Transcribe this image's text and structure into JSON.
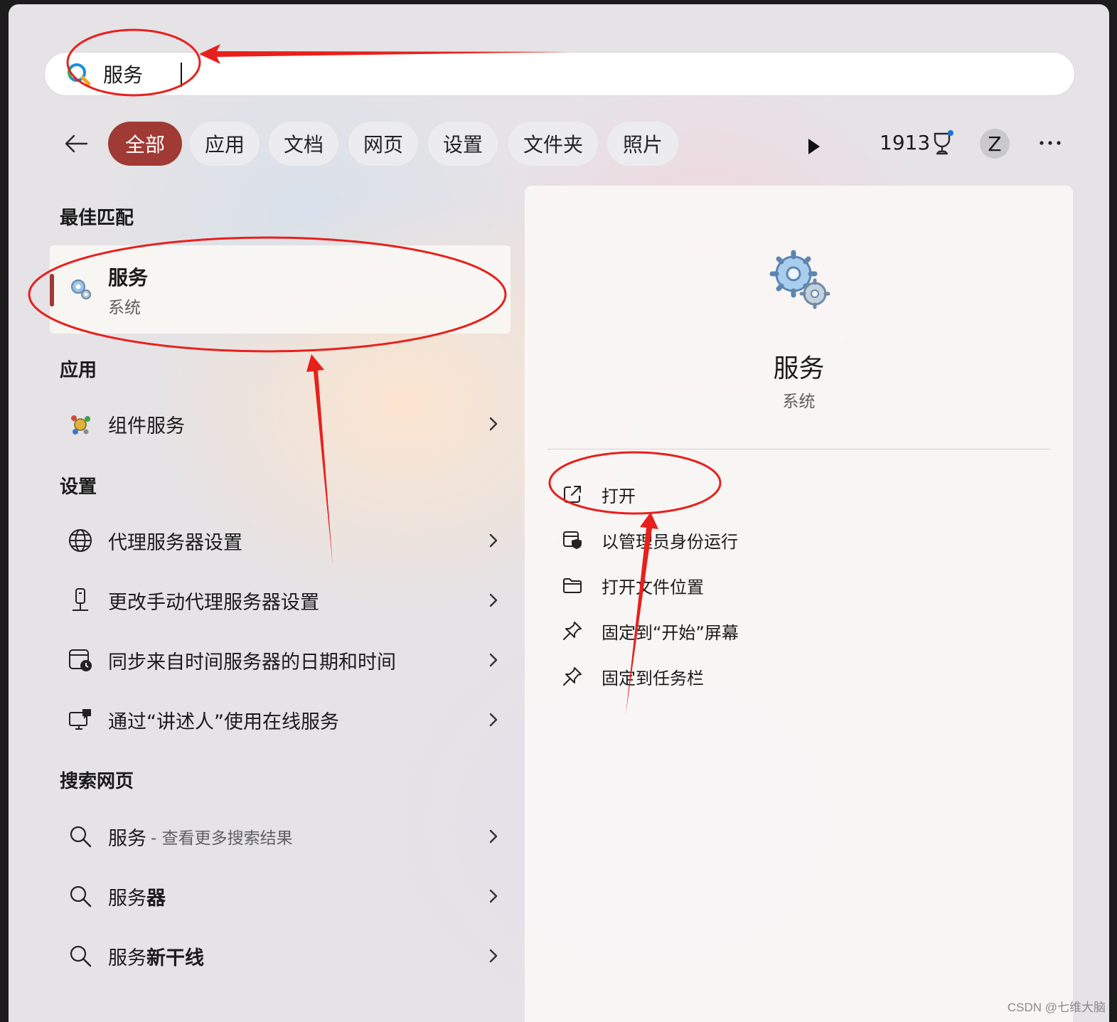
{
  "search": {
    "value": "服务",
    "placeholder": ""
  },
  "filters": [
    {
      "label": "全部",
      "active": true
    },
    {
      "label": "应用",
      "active": false
    },
    {
      "label": "文档",
      "active": false
    },
    {
      "label": "网页",
      "active": false
    },
    {
      "label": "设置",
      "active": false
    },
    {
      "label": "文件夹",
      "active": false
    },
    {
      "label": "照片",
      "active": false
    }
  ],
  "toolbar": {
    "points": "1913",
    "avatar_letter": "Z"
  },
  "best_match": {
    "heading": "最佳匹配",
    "title": "服务",
    "subtitle": "系统",
    "icon": "gears-icon"
  },
  "apps": {
    "heading": "应用",
    "items": [
      {
        "label": "组件服务",
        "icon": "component-services-icon"
      }
    ]
  },
  "settings": {
    "heading": "设置",
    "items": [
      {
        "label": "代理服务器设置",
        "icon": "globe-icon"
      },
      {
        "label": "更改手动代理服务器设置",
        "icon": "network-device-icon"
      },
      {
        "label": "同步来自时间服务器的日期和时间",
        "icon": "calendar-clock-icon"
      },
      {
        "label": "通过“讲述人”使用在线服务",
        "icon": "narrator-icon"
      }
    ]
  },
  "web": {
    "heading": "搜索网页",
    "items": [
      {
        "prefix": "服务",
        "bold": "",
        "suffix": "- 查看更多搜索结果"
      },
      {
        "prefix": "服务",
        "bold": "器",
        "suffix": ""
      },
      {
        "prefix": "服务",
        "bold": "新干线",
        "suffix": ""
      }
    ]
  },
  "detail": {
    "title": "服务",
    "subtitle": "系统",
    "actions": [
      {
        "label": "打开",
        "icon": "open-external-icon"
      },
      {
        "label": "以管理员身份运行",
        "icon": "admin-shield-icon"
      },
      {
        "label": "打开文件位置",
        "icon": "folder-icon"
      },
      {
        "label": "固定到“开始”屏幕",
        "icon": "pin-icon"
      },
      {
        "label": "固定到任务栏",
        "icon": "pin-icon"
      }
    ]
  },
  "watermark": "CSDN @七维大脑",
  "colors": {
    "accent": "#a03a34",
    "annotation": "#e8201c"
  }
}
